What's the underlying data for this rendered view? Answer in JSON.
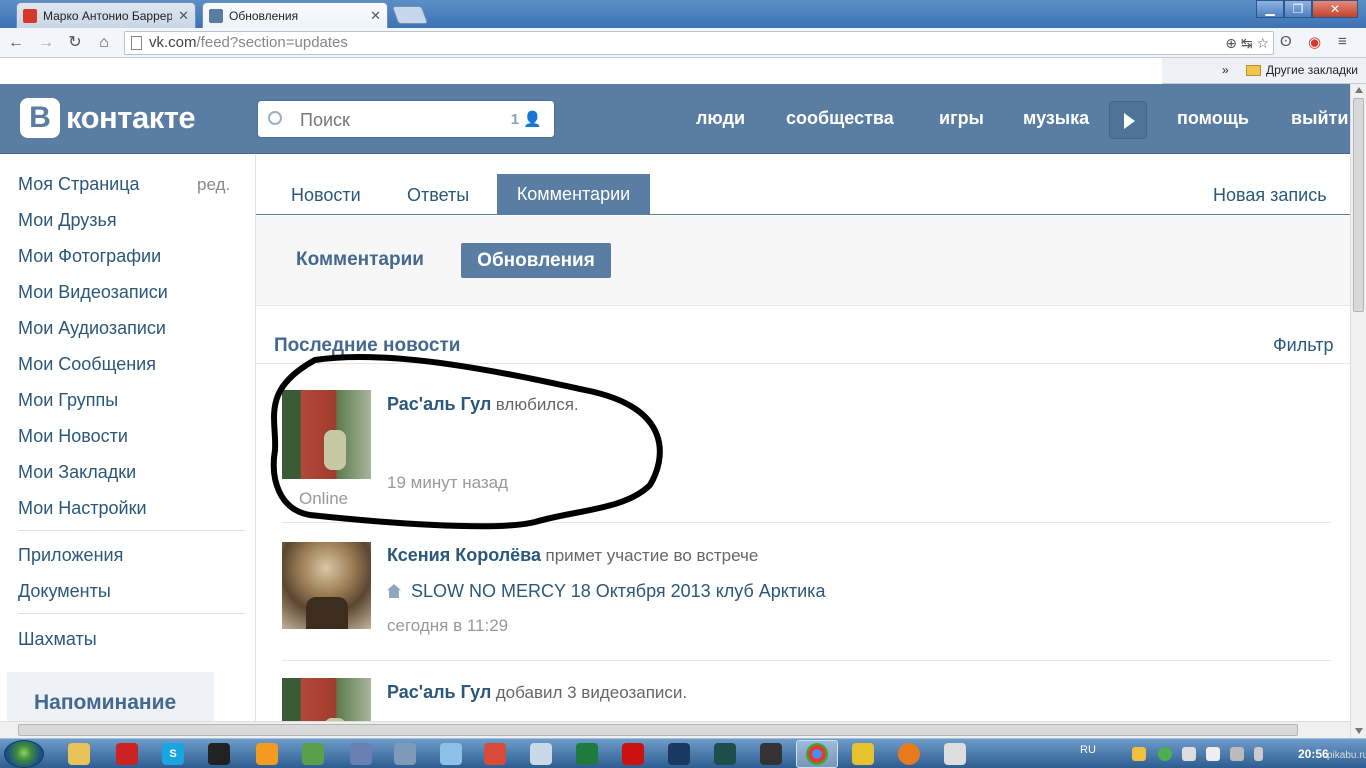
{
  "browser": {
    "tabs": [
      {
        "title": "Марко Антонио Баррера",
        "favicon_color": "#d33a2c"
      },
      {
        "title": "Обновления",
        "favicon_color": "#597da3"
      }
    ],
    "url_host": "vk.com",
    "url_path": "/feed?section=updates",
    "bookmarks_folder": "Другие закладки",
    "bookmarks_chevron": "»"
  },
  "vk": {
    "logo_letter": "В",
    "logo_word": "контакте",
    "search_placeholder": "Поиск",
    "search_count": "1",
    "nav": [
      "люди",
      "сообщества",
      "игры",
      "музыка",
      "помощь",
      "выйти"
    ]
  },
  "sidebar": {
    "items": [
      "Моя Страница",
      "Мои Друзья",
      "Мои Фотографии",
      "Мои Видеозаписи",
      "Мои Аудиозаписи",
      "Мои Сообщения",
      "Мои Группы",
      "Мои Новости",
      "Мои Закладки",
      "Мои Настройки"
    ],
    "edit_label": "ред.",
    "apps": [
      "Приложения",
      "Документы"
    ],
    "games": [
      "Шахматы"
    ],
    "reminder_label": "Напоминание"
  },
  "main": {
    "tabs": [
      "Новости",
      "Ответы",
      "Комментарии"
    ],
    "active_tab": "Комментарии",
    "new_post": "Новая запись",
    "subtabs": [
      "Комментарии",
      "Обновления"
    ],
    "active_subtab": "Обновления",
    "section_title": "Последние новости",
    "filter_label": "Фильтр"
  },
  "feed": [
    {
      "author": "Рас'аль Гул",
      "action": "влюбился.",
      "time": "19 минут назад",
      "online": "Online"
    },
    {
      "author": "Ксения Королёва",
      "action": "примет участие во встрече",
      "event": "SLOW NO MERCY 18 Октября 2013 клуб Арктика",
      "time": "сегодня в 11:29"
    },
    {
      "author": "Рас'аль Гул",
      "action": "добавил 3 видеозаписи."
    }
  ],
  "taskbar": {
    "language": "RU",
    "clock": "20:56"
  },
  "watermark": "pikabu.ru",
  "colors": {
    "vk_header": "#597da3",
    "link": "#2b587a",
    "heading": "#45688e"
  }
}
